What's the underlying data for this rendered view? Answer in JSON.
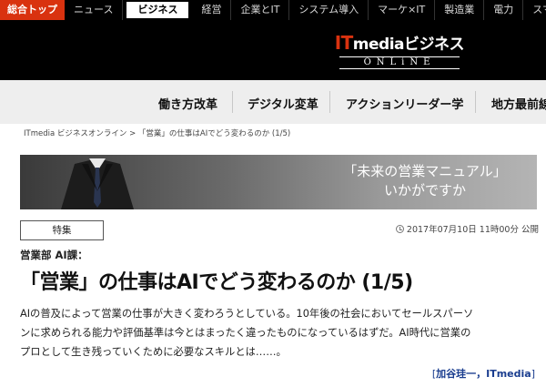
{
  "topnav": {
    "items": [
      {
        "label": "総合トップ"
      },
      {
        "label": "ニュース"
      },
      {
        "label": "ビジネス"
      },
      {
        "label": "経営"
      },
      {
        "label": "企業とIT"
      },
      {
        "label": "システム導入"
      },
      {
        "label": "マーケ×IT"
      },
      {
        "label": "製造業"
      },
      {
        "label": "電力"
      },
      {
        "label": "スマ"
      }
    ]
  },
  "header": {
    "logo_it": "IT",
    "logo_media": "media",
    "logo_jp": "ビジネス",
    "logo_sub": "ONLiNE"
  },
  "categories": [
    {
      "label": "働き方改革"
    },
    {
      "label": "デジタル変革"
    },
    {
      "label": "アクションリーダー学"
    },
    {
      "label": "地方最前線"
    }
  ],
  "breadcrumb": "ITmedia ビジネスオンライン > 「営業」の仕事はAIでどう変わるのか (1/5)",
  "banner": {
    "line1": "「未来の営業マニュアル」",
    "line2": "いかがですか"
  },
  "article": {
    "tag": "特集",
    "date": "2017年07月10日 11時00分 公開",
    "subtitle": "営業部 AI課：",
    "title": "「営業」の仕事はAIでどう変わるのか (1/5)",
    "lead_lines": [
      "AIの普及によって営業の仕事が大きく変わろうとしている。10年後の社会においてセールスパーソ",
      "ンに求められる能力や評価基準は今とはまったく違ったものになっているはずだ。AI時代に営業の",
      "プロとして生き残っていくために必要なスキルとは……。"
    ],
    "byline_open": "[",
    "byline_name": "加谷珪一，ITmedia",
    "byline_close": "]"
  },
  "colors": {
    "brand_red": "#d9320f",
    "header_bg": "#000000",
    "catbar_bg": "#eeeeee",
    "byline": "#1a3d8f"
  }
}
